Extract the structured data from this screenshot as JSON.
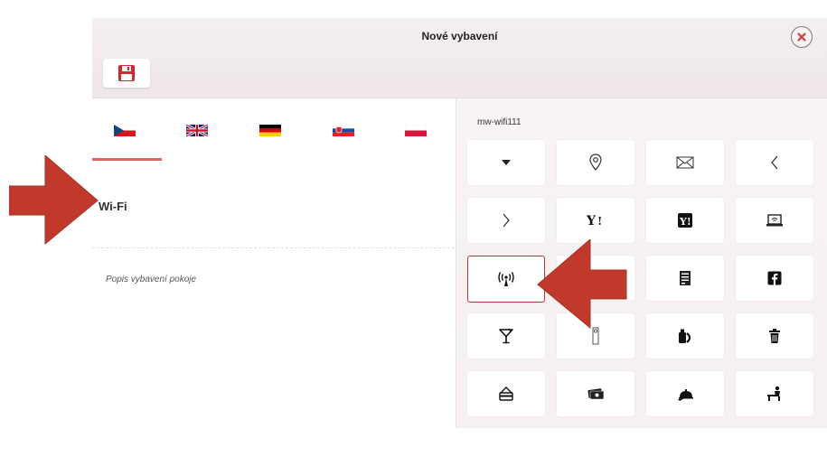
{
  "dialog": {
    "title": "Nové vybavení",
    "save_icon": "floppy-disk-icon",
    "close_icon": "close-icon"
  },
  "left": {
    "languages": [
      {
        "code": "cs",
        "icon": "flag-czech-icon"
      },
      {
        "code": "en",
        "icon": "flag-uk-icon"
      },
      {
        "code": "de",
        "icon": "flag-germany-icon"
      },
      {
        "code": "sk",
        "icon": "flag-slovakia-icon"
      },
      {
        "code": "pl",
        "icon": "flag-poland-icon"
      }
    ],
    "active_language": "cs",
    "name_value": "Wi-Fi",
    "description_placeholder": "Popis vybavení pokoje"
  },
  "right": {
    "selected_code": "mw-wifi111",
    "icons": [
      "caret-down-icon",
      "map-pin-icon",
      "envelope-icon",
      "chevron-left-icon",
      "chevron-right-icon",
      "yahoo-icon",
      "yahoo-square-icon",
      "laptop-wifi-icon",
      "wifi-antenna-icon",
      "unknown-icon",
      "server-icon",
      "facebook-icon",
      "cocktail-icon",
      "door-hanger-icon",
      "detergent-icon",
      "trash-icon",
      "card-reader-icon",
      "money-icon",
      "room-service-icon",
      "desk-person-icon"
    ],
    "selected_index": 8
  },
  "colors": {
    "accent": "#e06464",
    "selected_border": "#b33a3a",
    "arrow": "#c0392b"
  }
}
